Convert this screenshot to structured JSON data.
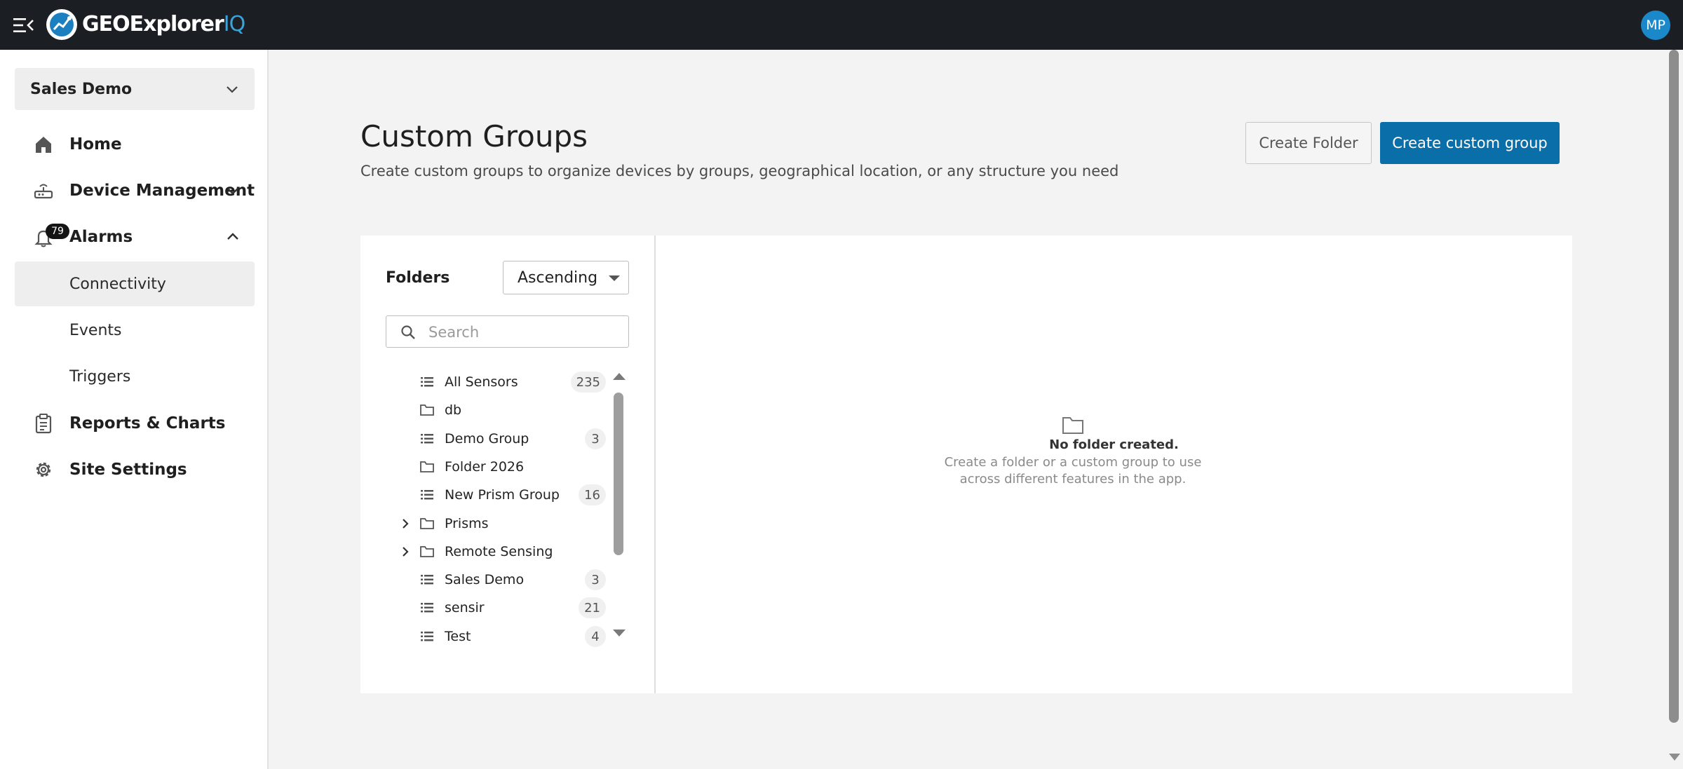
{
  "app": {
    "brand_name": "GEOExplorer",
    "brand_suffix": "IQ",
    "avatar_initials": "MP",
    "accent_color": "#0a6ea8",
    "topbar_color": "#1b1f24"
  },
  "sidebar": {
    "tenant": "Sales Demo",
    "items": [
      {
        "label": "Home",
        "icon": "home-icon"
      },
      {
        "label": "Device Management",
        "icon": "router-icon"
      },
      {
        "label": "Alarms",
        "icon": "bell-icon",
        "badge": "79"
      },
      {
        "label": "Reports & Charts",
        "icon": "clipboard-icon"
      },
      {
        "label": "Site Settings",
        "icon": "gear-icon"
      }
    ],
    "alarm_subitems": [
      {
        "label": "Connectivity",
        "active": true
      },
      {
        "label": "Events",
        "active": false
      },
      {
        "label": "Triggers",
        "active": false
      }
    ]
  },
  "page": {
    "title": "Custom Groups",
    "subtitle": "Create custom groups to organize devices by groups, geographical location, or any structure you need",
    "create_folder_label": "Create Folder",
    "create_group_label": "Create custom group"
  },
  "folders": {
    "title": "Folders",
    "sort_value": "Ascending",
    "search_placeholder": "Search",
    "items": [
      {
        "label": "All Sensors",
        "type": "group",
        "count": "235",
        "expandable": false
      },
      {
        "label": "db",
        "type": "folder",
        "count": "",
        "expandable": false
      },
      {
        "label": "Demo Group",
        "type": "group",
        "count": "3",
        "expandable": false
      },
      {
        "label": "Folder 2026",
        "type": "folder",
        "count": "",
        "expandable": false
      },
      {
        "label": "New Prism Group",
        "type": "group",
        "count": "16",
        "expandable": false
      },
      {
        "label": "Prisms",
        "type": "folder",
        "count": "",
        "expandable": true
      },
      {
        "label": "Remote Sensing",
        "type": "folder",
        "count": "",
        "expandable": true
      },
      {
        "label": "Sales Demo",
        "type": "group",
        "count": "3",
        "expandable": false
      },
      {
        "label": "sensir",
        "type": "group",
        "count": "21",
        "expandable": false
      },
      {
        "label": "Test",
        "type": "group",
        "count": "4",
        "expandable": false
      }
    ]
  },
  "empty_state": {
    "title": "No folder created.",
    "description": "Create a folder or a custom group to use across different features in the app."
  }
}
